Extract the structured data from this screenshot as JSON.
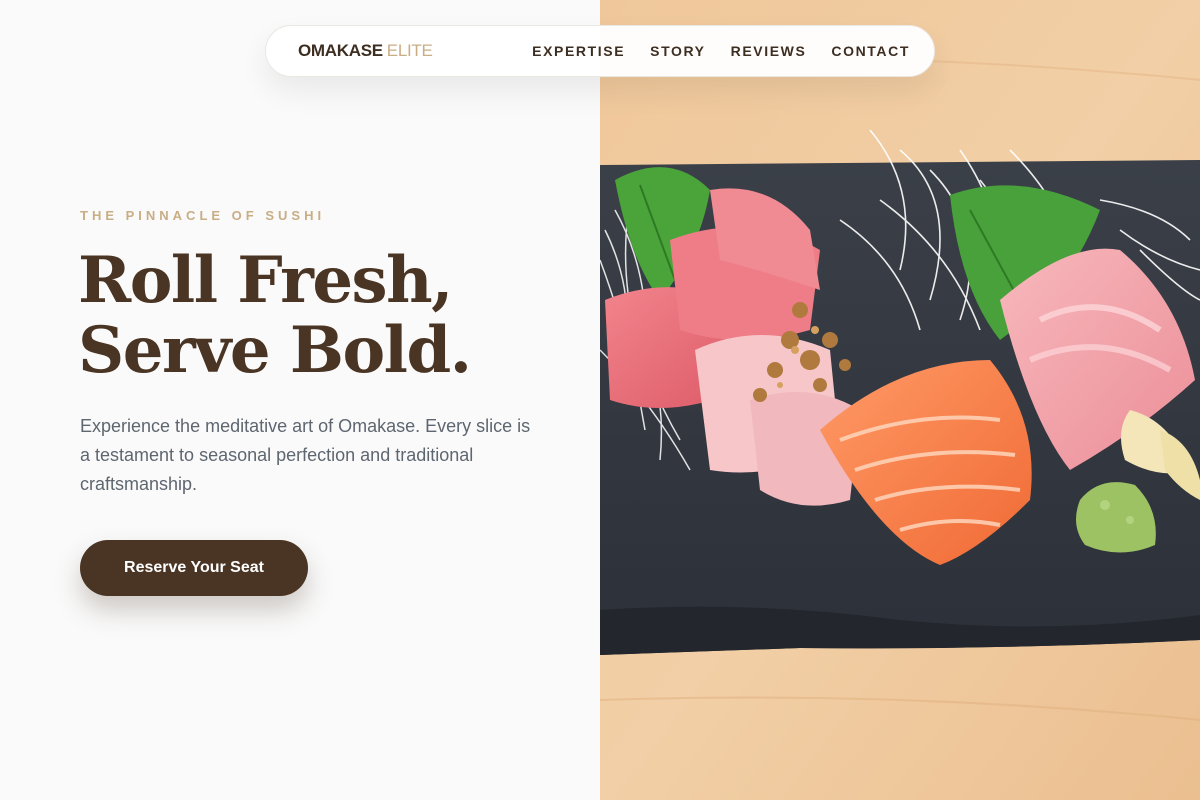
{
  "nav": {
    "brand_main": "OMAKASE",
    "brand_accent": "ELITE",
    "links": [
      "EXPERTISE",
      "STORY",
      "REVIEWS",
      "CONTACT"
    ]
  },
  "hero": {
    "eyebrow": "THE PINNACLE OF SUSHI",
    "headline_line1": "Roll Fresh,",
    "headline_line2": "Serve Bold.",
    "description": "Experience the meditative art of Omakase. Every slice is a testament to seasonal perfection and traditional craftsmanship.",
    "cta_label": "Reserve Your Seat"
  },
  "colors": {
    "brand_brown": "#4a3423",
    "accent_gold": "#c8ad85",
    "background": "#fafafa",
    "body_text": "#5e6670"
  }
}
